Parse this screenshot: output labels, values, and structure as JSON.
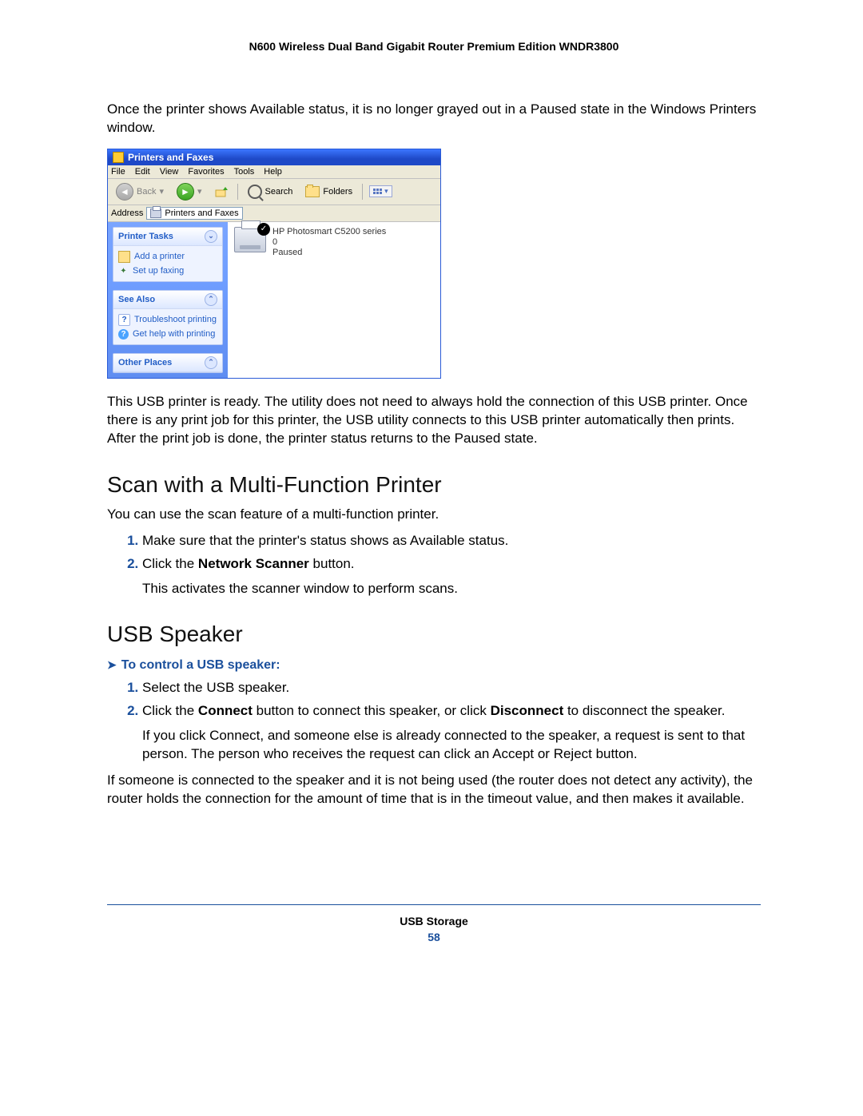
{
  "header": {
    "title": "N600 Wireless Dual Band Gigabit Router Premium Edition WNDR3800"
  },
  "para1": "Once the printer shows Available status, it is no longer grayed out in a Paused state in the Windows Printers window.",
  "xp": {
    "title": "Printers and Faxes",
    "menu": {
      "file": "File",
      "edit": "Edit",
      "view": "View",
      "favorites": "Favorites",
      "tools": "Tools",
      "help": "Help"
    },
    "toolbar": {
      "back": "Back",
      "search": "Search",
      "folders": "Folders"
    },
    "address_label": "Address",
    "address_value": "Printers and Faxes",
    "panels": {
      "tasks": {
        "title": "Printer Tasks",
        "items": {
          "add": "Add a printer",
          "fax": "Set up faxing"
        }
      },
      "seealso": {
        "title": "See Also",
        "items": {
          "trouble": "Troubleshoot printing",
          "help": "Get help with printing"
        }
      },
      "other": {
        "title": "Other Places"
      }
    },
    "printer": {
      "name": "HP Photosmart C5200 series",
      "docs": "0",
      "status": "Paused"
    }
  },
  "para2": "This USB printer is ready. The utility does not need to always hold the connection of this USB printer. Once there is any print job for this printer, the USB utility connects to this USB printer automatically then prints. After the print job is done, the printer status returns to the Paused state.",
  "scan": {
    "heading": "Scan with a Multi-Function Printer",
    "intro": "You can use the scan feature of a multi-function printer.",
    "step1": "Make sure that the printer's status shows as Available status.",
    "step2_a": "Click the ",
    "step2_b": "Network Scanner",
    "step2_c": " button.",
    "step2_sub": "This activates the scanner window to perform scans."
  },
  "usb": {
    "heading": "USB Speaker",
    "task": "To control a USB speaker:",
    "step1": "Select the USB speaker.",
    "step2_a": "Click the ",
    "step2_b": "Connect",
    "step2_c": " button to connect this speaker, or click ",
    "step2_d": "Disconnect",
    "step2_e": " to disconnect the speaker.",
    "step2_sub": "If you click Connect, and someone else is already connected to the speaker, a request is sent to that person. The person who receives the request can click an Accept or Reject button.",
    "after": "If someone is connected to the speaker and it is not being used (the router does not detect any activity), the router holds the connection for the amount of time that is in the timeout value, and then makes it available."
  },
  "footer": {
    "section": "USB Storage",
    "page": "58"
  }
}
